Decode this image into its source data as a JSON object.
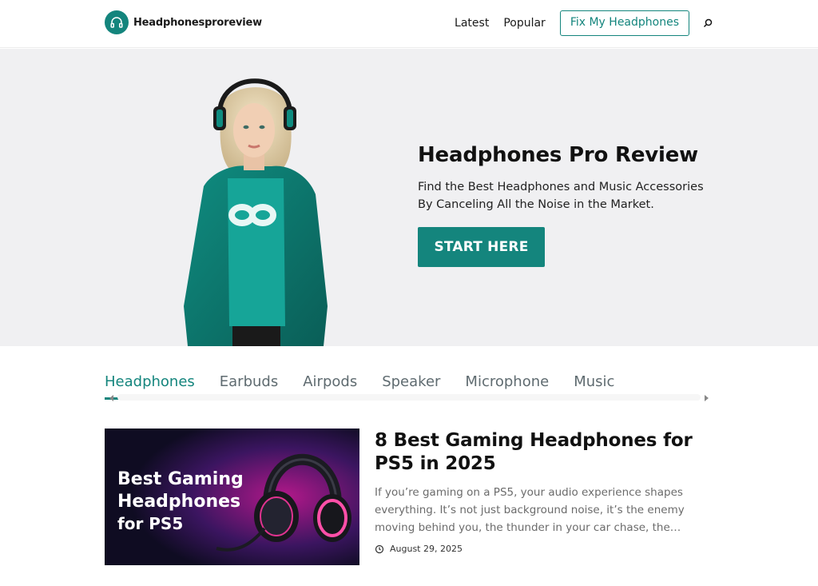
{
  "header": {
    "logo_text": "Headphonesproreview",
    "nav": [
      "Latest",
      "Popular"
    ],
    "cta_label": "Fix My Headphones",
    "search_icon": "search-icon"
  },
  "hero": {
    "title": "Headphones Pro Review",
    "subtitle": "Find the Best Headphones and Music Accessories By Canceling All the Noise in the Market.",
    "button_label": "START HERE"
  },
  "tabs": {
    "items": [
      "Headphones",
      "Earbuds",
      "Airpods",
      "Speaker",
      "Microphone",
      "Music"
    ],
    "active": "Headphones"
  },
  "post": {
    "thumb_text_1": "Best Gaming",
    "thumb_text_2": "Headphones",
    "thumb_text_3": "for PS5",
    "title": "8 Best Gaming Headphones for PS5 in 2025",
    "excerpt": "If you’re gaming on a PS5, your audio experience shapes everything. It’s not just background noise, it’s the enemy moving behind you, the thunder in your car chase, the…",
    "date": "August 29, 2025"
  },
  "colors": {
    "accent": "#14857d",
    "hero_bg": "#f0f0f2",
    "thumb_bg": "#0f0c22"
  }
}
